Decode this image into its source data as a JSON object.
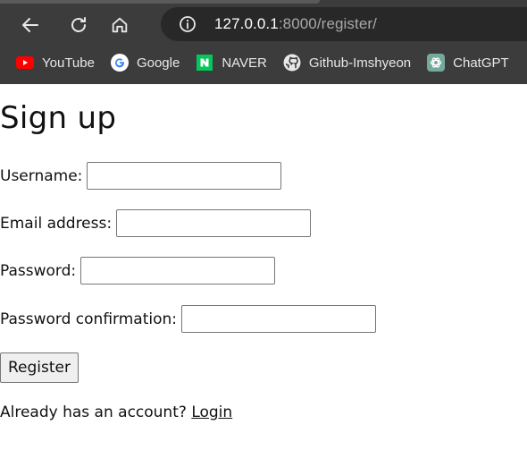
{
  "browser": {
    "url_host": "127.0.0.1",
    "url_path": ":8000/register/",
    "bookmarks": [
      {
        "label": "YouTube",
        "icon": "youtube-icon"
      },
      {
        "label": "Google",
        "icon": "google-icon"
      },
      {
        "label": "NAVER",
        "icon": "naver-icon"
      },
      {
        "label": "Github-Imshyeon",
        "icon": "github-icon"
      },
      {
        "label": "ChatGPT",
        "icon": "chatgpt-icon"
      }
    ]
  },
  "page": {
    "title": "Sign up",
    "fields": [
      {
        "label": "Username:",
        "value": ""
      },
      {
        "label": "Email address:",
        "value": ""
      },
      {
        "label": "Password:",
        "value": ""
      },
      {
        "label": "Password confirmation:",
        "value": ""
      }
    ],
    "submit_label": "Register",
    "footer_text": "Already has an account? ",
    "footer_link": "Login"
  },
  "colors": {
    "chrome_bg": "#3c3c3c",
    "omnibox_bg": "#282828",
    "youtube_red": "#ff0000",
    "naver_green": "#03c75a",
    "chatgpt_teal": "#74aa9c"
  }
}
